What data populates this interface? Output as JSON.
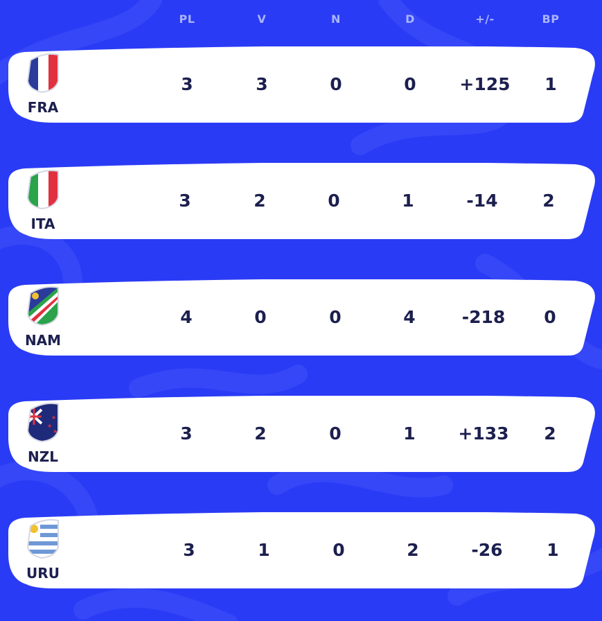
{
  "header": {
    "pl": "PL",
    "v": "V",
    "n": "N",
    "d": "D",
    "diff": "+/-",
    "bp": "BP"
  },
  "rows": [
    {
      "code": "FRA",
      "flag_icon": "france-flag-icon",
      "pl": "3",
      "v": "3",
      "n": "0",
      "d": "0",
      "diff": "+125",
      "bp": "1"
    },
    {
      "code": "ITA",
      "flag_icon": "italy-flag-icon",
      "pl": "3",
      "v": "2",
      "n": "0",
      "d": "1",
      "diff": "-14",
      "bp": "2"
    },
    {
      "code": "NAM",
      "flag_icon": "namibia-flag-icon",
      "pl": "4",
      "v": "0",
      "n": "0",
      "d": "4",
      "diff": "-218",
      "bp": "0"
    },
    {
      "code": "NZL",
      "flag_icon": "new-zealand-flag-icon",
      "pl": "3",
      "v": "2",
      "n": "0",
      "d": "1",
      "diff": "+133",
      "bp": "2"
    },
    {
      "code": "URU",
      "flag_icon": "uruguay-flag-icon",
      "pl": "3",
      "v": "1",
      "n": "0",
      "d": "2",
      "diff": "-26",
      "bp": "1"
    }
  ],
  "colors": {
    "background": "#2a3bf5",
    "row_background": "#ffffff",
    "header_text": "#a9b4ff",
    "row_text": "#1c1f4e"
  }
}
